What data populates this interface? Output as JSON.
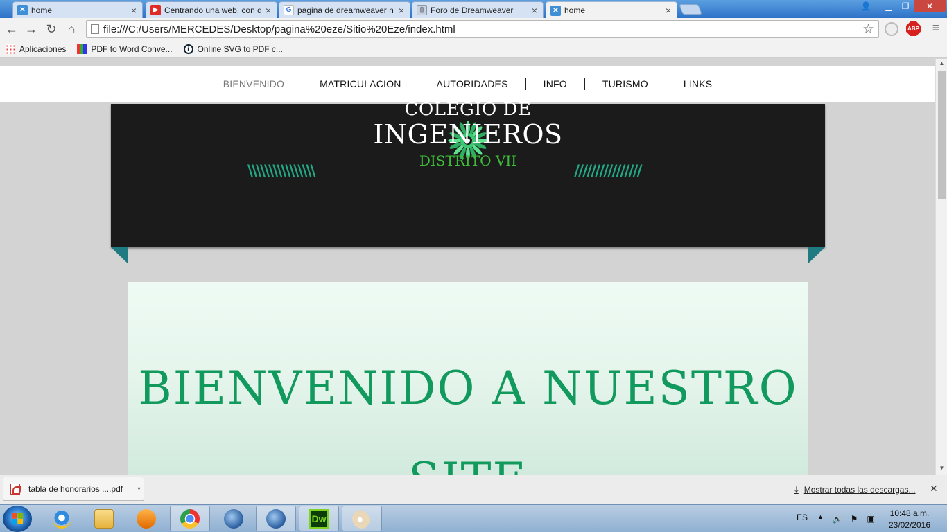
{
  "browser": {
    "tabs": [
      {
        "title": "home",
        "icon": "dreamweaver-site-icon",
        "active": false
      },
      {
        "title": "Centrando una web, con d",
        "icon": "youtube-icon",
        "active": false
      },
      {
        "title": "pagina de dreamweaver n",
        "icon": "google-icon",
        "active": false
      },
      {
        "title": "Foro de Dreamweaver",
        "icon": "forum-page-icon",
        "active": false
      },
      {
        "title": "home",
        "icon": "dreamweaver-site-icon",
        "active": true
      }
    ],
    "address": "file:///C:/Users/MERCEDES/Desktop/pagina%20eze/Sitio%20Eze/index.html",
    "bookmarks": [
      {
        "label": "Aplicaciones",
        "icon": "apps-grid-icon"
      },
      {
        "label": "PDF to Word Conve...",
        "icon": "pdf-converter-icon"
      },
      {
        "label": "Online SVG to PDF c...",
        "icon": "info-icon"
      }
    ],
    "abp_label": "ABP"
  },
  "site": {
    "nav": [
      "BIENVENIDO",
      "MATRICULACION",
      "AUTORIDADES",
      "INFO",
      "TURISMO",
      "LINKS"
    ],
    "nav_current": "BIENVENIDO",
    "logo": {
      "line1": "COLEGIO DE",
      "line2": "INGENIEROS",
      "line3": "DISTRITO VII",
      "slashes_left": "\\\\\\\\\\\\\\\\\\\\\\\\\\\\\\\\",
      "slashes_right": "////////////////"
    },
    "welcome_title": "BIENVENIDO A NUESTRO SITE",
    "colors": {
      "header_bg": "#1b1b1b",
      "accent_green": "#129a5e",
      "ribbon": "#1f7a82",
      "distrito": "#3ebc3a"
    }
  },
  "downloads": {
    "item": "tabla de honorarios ....pdf",
    "show_all": "Mostrar todas las descargas..."
  },
  "taskbar": {
    "apps": [
      "internet-explorer",
      "windows-explorer",
      "media-player",
      "google-chrome",
      "thunderbird",
      "thunderbird",
      "dreamweaver",
      "paint"
    ],
    "dw_label": "Dw",
    "lang": "ES",
    "time": "10:48 a.m.",
    "date": "23/02/2016"
  }
}
